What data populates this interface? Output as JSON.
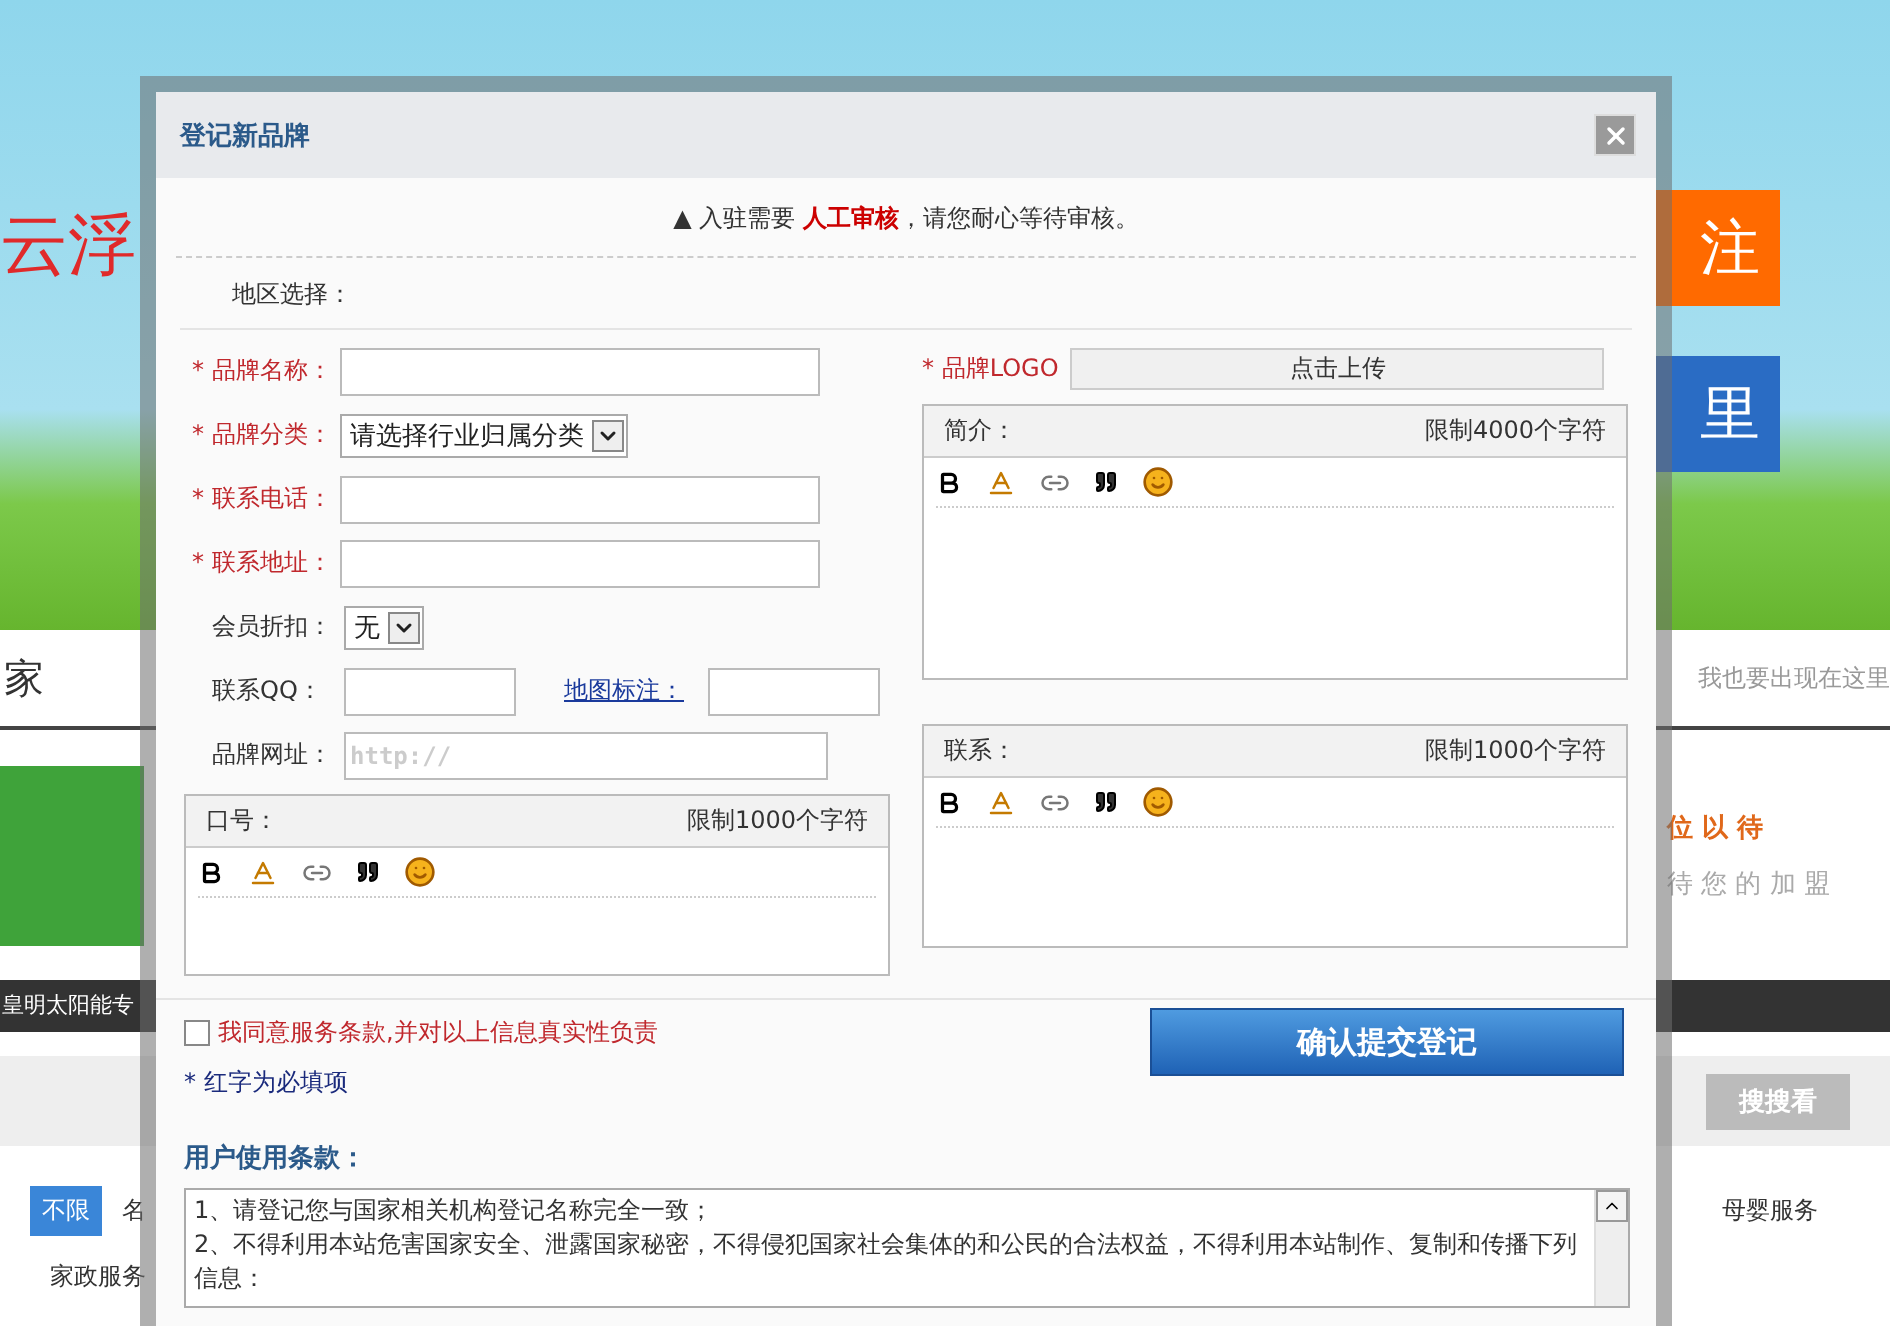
{
  "background_page": {
    "logo_text": "云浮",
    "header_buttons": [
      "注",
      "里"
    ],
    "nav_tab": "家",
    "nav_link": "我也要出现在这里",
    "promo_lines": [
      "位 以 待",
      "待 您 的 加 盟"
    ],
    "banner_caption": "皇明太阳能专",
    "search_button": "搜搜看",
    "categories": [
      {
        "label": "不限",
        "selected": true
      },
      {
        "label": "名",
        "selected": false
      },
      {
        "label": "母婴服务",
        "selected": false
      },
      {
        "label": "家政服务",
        "selected": false
      }
    ]
  },
  "dialog": {
    "title": "登记新品牌",
    "notice": "▲ 入驻需要 **人工审核**，请您耐心等待审核。",
    "region_label": "地区选择：",
    "left_fields": [
      {
        "kind": "text",
        "label": "* 品牌名称：",
        "required": true
      },
      {
        "kind": "select",
        "label": "* 品牌分类：",
        "required": true,
        "value": "请选择行业归属分类"
      },
      {
        "kind": "text",
        "label": "* 联系电话：",
        "required": true
      },
      {
        "kind": "text",
        "label": "* 联系地址：",
        "required": true
      },
      {
        "kind": "select",
        "label": "会员折扣：",
        "required": false,
        "value": "无"
      },
      {
        "kind": "pair",
        "label": "联系QQ：",
        "required": false,
        "link": "地图标注："
      },
      {
        "kind": "url",
        "label": "品牌网址：",
        "required": false,
        "placeholder": "http://"
      }
    ],
    "logo_label": "* 品牌LOGO",
    "upload_button": "点击上传",
    "slogan_editor": {
      "label": "口号：",
      "limit": "限制1000个字符"
    },
    "right_editors": [
      {
        "label": "简介：",
        "limit": "限制4000个字符"
      },
      {
        "label": "联系：",
        "limit": "限制1000个字符"
      }
    ],
    "agree": {
      "label": "我同意服务条款,并对以上信息真实性负责",
      "checked": false
    },
    "required_note": "* 红字为必填项",
    "submit_button": "确认提交登记",
    "terms_title": "用户使用条款：",
    "terms_lines": [
      "1、请登记您与国家相关机构登记名称完全一致；",
      "2、不得利用本站危害国家安全、泄露国家秘密，不得侵犯国家社会集体的和公民的合法权益，不得利用本站制作、复制和传播下列信息："
    ]
  }
}
